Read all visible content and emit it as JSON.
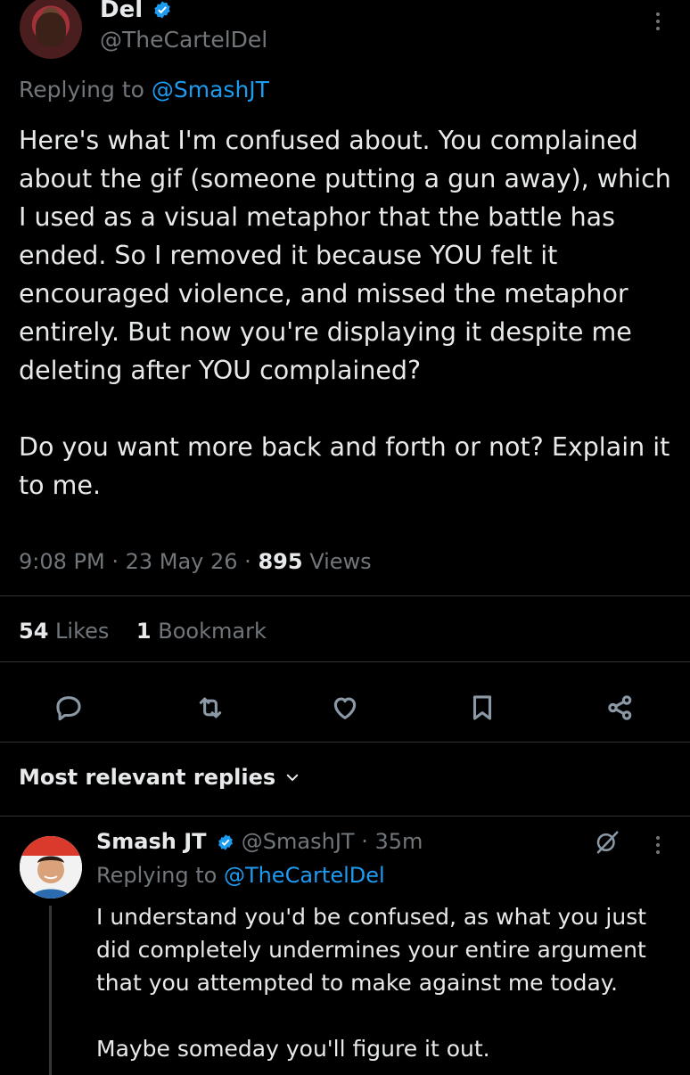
{
  "tweet": {
    "author_name": "Del",
    "author_handle": "@TheCartelDel",
    "replying_prefix": "Replying to ",
    "replying_to": "@SmashJT",
    "text": "Here's what I'm confused about. You complained about the gif (someone putting a gun away), which I used as a visual metaphor that the battle has ended. So I removed it because YOU felt it encouraged violence, and missed the metaphor entirely. But now you're displaying it despite me deleting after YOU complained?\n\nDo you want more back and forth or not? Explain it to me.",
    "time": "9:08 PM",
    "date": "23 May 26",
    "views_count": "895",
    "views_label": "Views",
    "likes_count": "54",
    "likes_label": "Likes",
    "bookmarks_count": "1",
    "bookmarks_label": "Bookmark"
  },
  "actions": [
    "reply-icon",
    "retweet-icon",
    "like-icon",
    "bookmark-icon",
    "share-icon"
  ],
  "sort": {
    "label": "Most relevant replies"
  },
  "reply": {
    "author_name": "Smash JT",
    "author_handle": "@SmashJT",
    "age": "35m",
    "replying_prefix": "Replying to ",
    "replying_to": "@TheCartelDel",
    "text": "I understand you'd be confused, as what you just did completely undermines your entire argument that you attempted to make against me today.\n\nMaybe someday you'll figure it out."
  },
  "colors": {
    "background": "#000000",
    "accent": "#1d9bf0",
    "muted": "#71767b",
    "text": "#e7e9ea"
  }
}
